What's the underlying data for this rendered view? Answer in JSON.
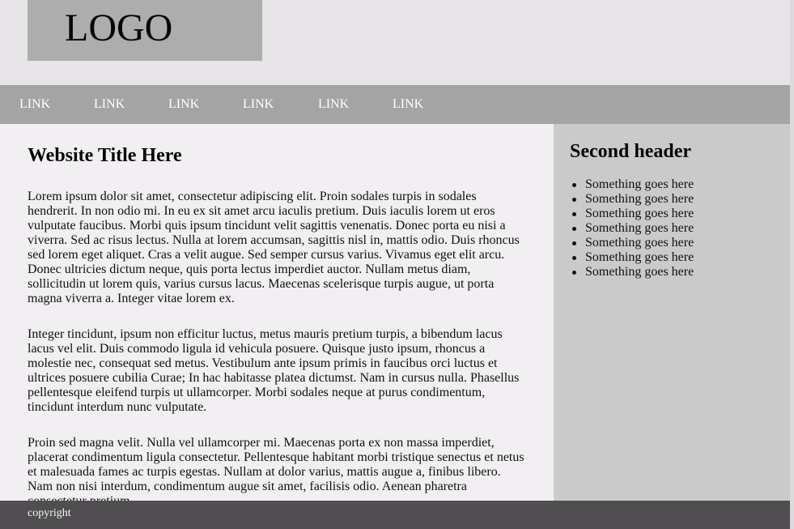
{
  "header": {
    "logo_text": "LOGO"
  },
  "nav": {
    "links": [
      "LINK",
      "LINK",
      "LINK",
      "LINK",
      "LINK",
      "LINK"
    ]
  },
  "main": {
    "title": "Website Title Here",
    "paragraphs": [
      "Lorem ipsum dolor sit amet, consectetur adipiscing elit. Proin sodales turpis in sodales hendrerit. In non odio mi. In eu ex sit amet arcu iaculis pretium. Duis iaculis lorem ut eros vulputate faucibus. Morbi quis ipsum tincidunt velit sagittis venenatis. Donec porta eu nisi a viverra. Sed ac risus lectus. Nulla at lorem accumsan, sagittis nisl in, mattis odio. Duis rhoncus sed lorem eget aliquet. Cras a velit augue. Sed semper cursus varius. Vivamus eget elit arcu. Donec ultricies dictum neque, quis porta lectus imperdiet auctor. Nullam metus diam, sollicitudin ut lorem quis, varius cursus lacus. Maecenas scelerisque turpis augue, ut porta magna viverra a. Integer vitae lorem ex.",
      "Integer tincidunt, ipsum non efficitur luctus, metus mauris pretium turpis, a bibendum lacus lacus vel elit. Duis commodo ligula id vehicula posuere. Quisque justo ipsum, rhoncus a molestie nec, consequat sed metus. Vestibulum ante ipsum primis in faucibus orci luctus et ultrices posuere cubilia Curae; In hac habitasse platea dictumst. Nam in cursus nulla. Phasellus pellentesque eleifend turpis ut ullamcorper. Morbi sodales neque at purus condimentum, tincidunt interdum nunc vulputate.",
      "Proin sed magna velit. Nulla vel ullamcorper mi. Maecenas porta ex non massa imperdiet, placerat condimentum ligula consectetur. Pellentesque habitant morbi tristique senectus et netus et malesuada fames ac turpis egestas. Nullam at dolor varius, mattis augue a, finibus libero. Nam non nisi interdum, condimentum augue sit amet, facilisis odio. Aenean pharetra consectetur pretium."
    ]
  },
  "sidebar": {
    "title": "Second header",
    "items": [
      "Something goes here",
      "Something goes here",
      "Something goes here",
      "Something goes here",
      "Something goes here",
      "Something goes here",
      "Something goes here"
    ]
  },
  "footer": {
    "text": "copyright"
  },
  "colors": {
    "page_background": "#f1eff1",
    "header_background": "#e6e4e6",
    "logo_background": "#adadad",
    "nav_background": "#a5a4a5",
    "nav_text": "#ffffff",
    "sidebar_background": "#cbcacb",
    "footer_background": "#504e50",
    "footer_text": "#f6f6f6"
  }
}
